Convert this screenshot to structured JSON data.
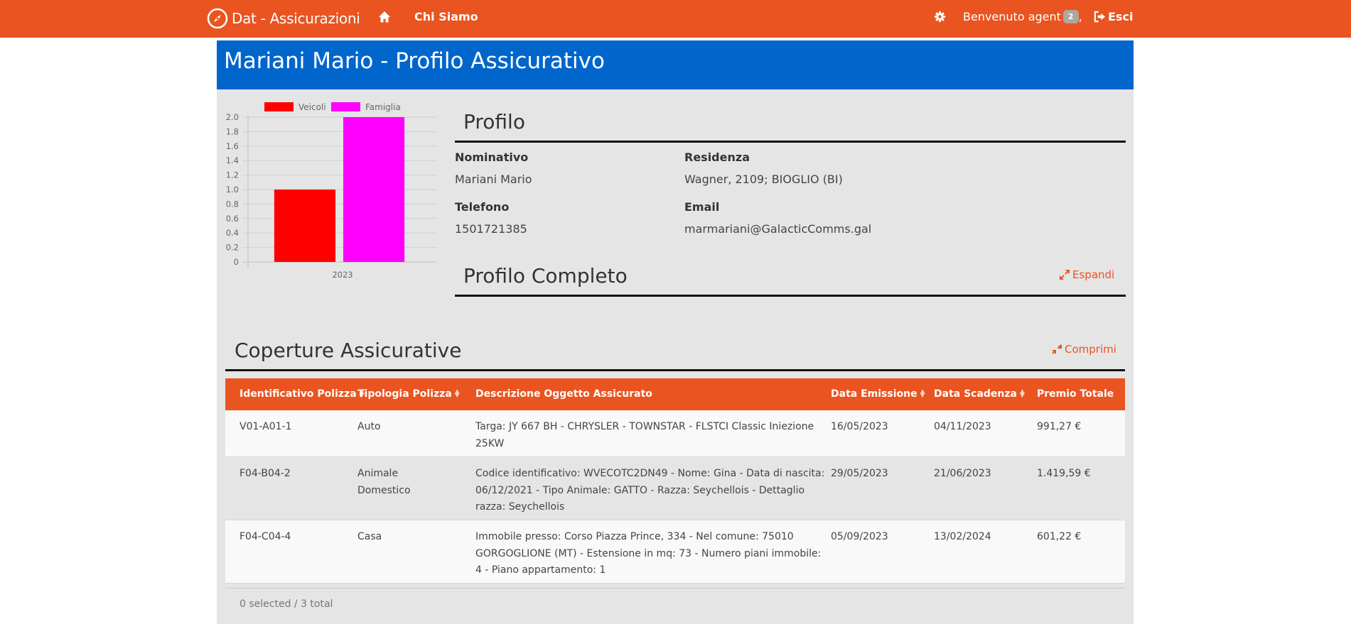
{
  "nav": {
    "brand": "Dat - Assicurazioni",
    "chi_siamo": "Chi Siamo",
    "welcome": "Benvenuto agent",
    "badge": "2",
    "comma": ",",
    "logout": "Esci",
    "icons": {
      "brand": "compass-icon",
      "home": "home-icon",
      "settings": "gear-icon",
      "logout": "sign-out-icon"
    },
    "color": "#E95420"
  },
  "header": {
    "title": "Mariani Mario - Profilo Assicurativo",
    "color": "#0066CC"
  },
  "chart_data": {
    "type": "bar",
    "categories": [
      "2023"
    ],
    "series": [
      {
        "name": "Veicoli",
        "values": [
          1
        ],
        "color": "#FF0000"
      },
      {
        "name": "Famiglia",
        "values": [
          2
        ],
        "color": "#FF00FF"
      }
    ],
    "ylim": [
      0,
      2
    ],
    "yticks": [
      "0",
      "0.2",
      "0.4",
      "0.6",
      "0.8",
      "1.0",
      "1.2",
      "1.4",
      "1.6",
      "1.8",
      "2.0"
    ],
    "legend": "top",
    "grid": true
  },
  "profilo": {
    "title": "Profilo",
    "fields": {
      "nominativo": {
        "label": "Nominativo",
        "value": "Mariani Mario"
      },
      "residenza": {
        "label": "Residenza",
        "value": "Wagner, 2109; BIOGLIO (BI)"
      },
      "telefono": {
        "label": "Telefono",
        "value": "1501721385"
      },
      "email": {
        "label": "Email",
        "value": "marmariani@GalacticComms.gal"
      }
    }
  },
  "profilo_completo": {
    "title": "Profilo Completo",
    "expand": "Espandi"
  },
  "coperture": {
    "title": "Coperture Assicurative",
    "collapse": "Comprimi",
    "columns": [
      "Identificativo Polizza",
      "Tipologia Polizza",
      "Descrizione Oggetto Assicurato",
      "Data Emissione",
      "Data Scadenza",
      "Premio Totale"
    ],
    "rows": [
      {
        "id": "V01-A01-1",
        "tipologia": "Auto",
        "descrizione": [
          "Targa: JY 667 BH - CHRYSLER - TOWNSTAR - FLSTCI Classic Iniezione",
          "25KW"
        ],
        "emissione": "16/05/2023",
        "scadenza": "04/11/2023",
        "premio": "991,27 €"
      },
      {
        "id": "F04-B04-2",
        "tipologia": [
          "Animale",
          "Domestico"
        ],
        "descrizione": [
          "Codice identificativo: WVECOTC2DN49 - Nome: Gina - Data di nascita:",
          "06/12/2021 - Tipo Animale: GATTO - Razza: Seychellois - Dettaglio",
          "razza: Seychellois"
        ],
        "emissione": "29/05/2023",
        "scadenza": "21/06/2023",
        "premio": "1.419,59 €"
      },
      {
        "id": "F04-C04-4",
        "tipologia": "Casa",
        "descrizione": [
          "Immobile presso: Corso Piazza Prince, 334 - Nel comune: 75010",
          "GORGOGLIONE (MT) - Estensione in mq: 73 - Numero piani immobile:",
          "4 - Piano appartamento: 1"
        ],
        "emissione": "05/09/2023",
        "scadenza": "13/02/2024",
        "premio": "601,22 €"
      }
    ],
    "footer": "0 selected / 3 total"
  }
}
